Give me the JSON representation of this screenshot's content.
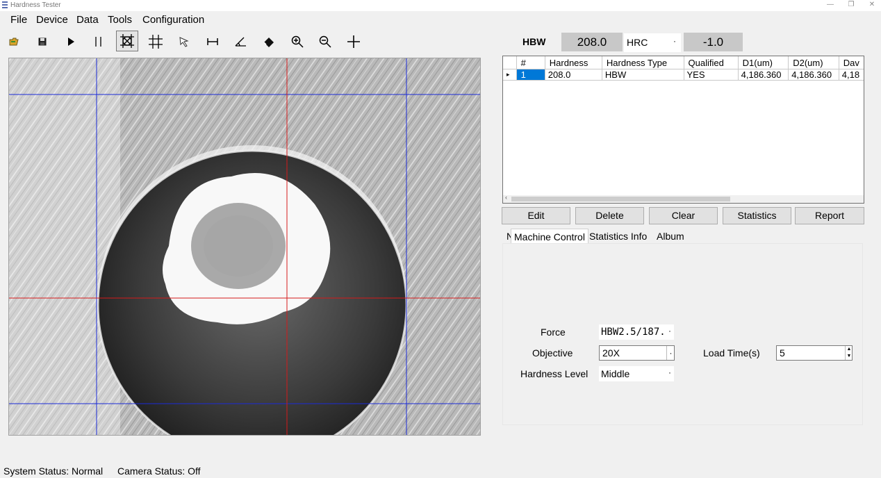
{
  "window": {
    "title": "Hardness Tester"
  },
  "menu": [
    "File",
    "Device",
    "Data",
    "Tools",
    "Configuration"
  ],
  "toolbar": [
    "open-icon",
    "save-icon",
    "play-icon",
    "pause-icon",
    "measure-circle-icon",
    "grid-icon",
    "pointer-icon",
    "distance-icon",
    "angle-icon",
    "eraser-icon",
    "zoom-in-icon",
    "zoom-out-icon",
    "crosshair-icon"
  ],
  "hardness": {
    "label": "HBW",
    "value": "208.0",
    "convert_type": "HRC",
    "convert_value": "-1.0"
  },
  "table": {
    "columns": [
      "#",
      "Hardness",
      "Hardness Type",
      "Qualified",
      "D1(um)",
      "D2(um)",
      "Dav"
    ],
    "rows": [
      {
        "num": "1",
        "hardness": "208.0",
        "type": "HBW",
        "qualified": "YES",
        "d1": "4,186.360",
        "d2": "4,186.360",
        "dav": "4,18"
      }
    ]
  },
  "buttons": {
    "edit": "Edit",
    "delete": "Delete",
    "clear": "Clear",
    "statistics": "Statistics",
    "report": "Report"
  },
  "tabs": {
    "stub": "N",
    "machine": "Machine Control",
    "stats": "Statistics Info",
    "album": "Album"
  },
  "machine": {
    "force_label": "Force",
    "force_value": "HBW2.5/187.",
    "objective_label": "Objective",
    "objective_value": "20X",
    "level_label": "Hardness Level",
    "level_value": "Middle",
    "load_label": "Load Time(s)",
    "load_value": "5"
  },
  "status": {
    "system": "System Status: Normal",
    "camera": "Camera Status: Off"
  }
}
